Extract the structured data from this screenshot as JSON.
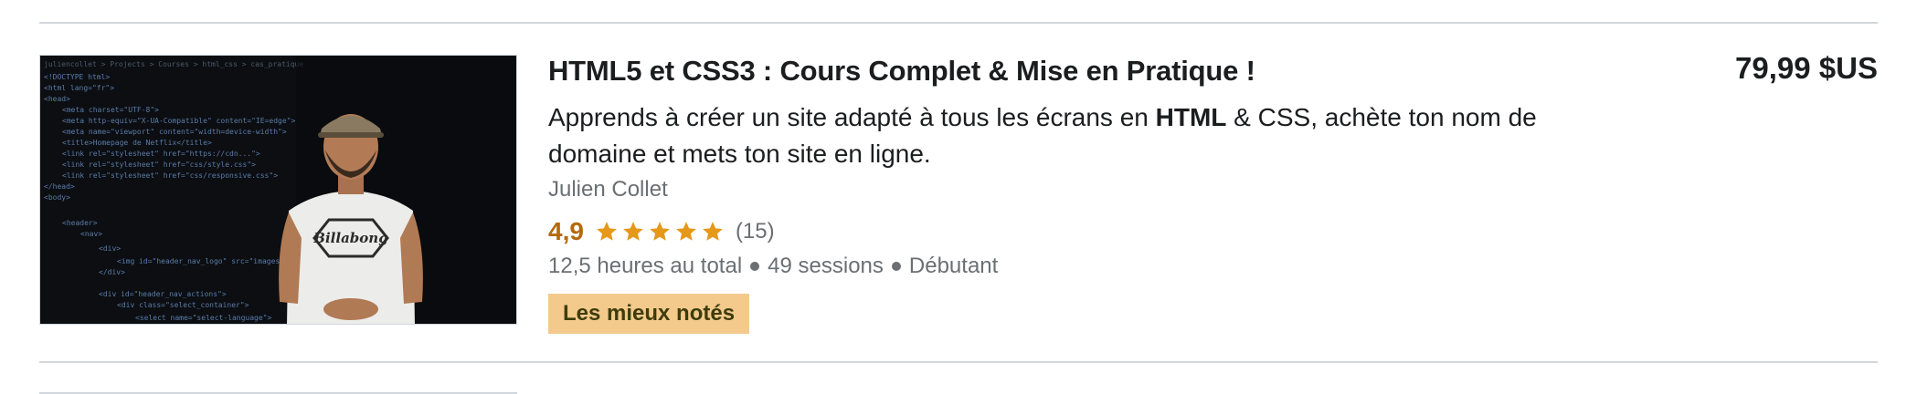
{
  "course": {
    "title": "HTML5 et CSS3 : Cours Complet & Mise en Pratique !",
    "description_pre": "Apprends à créer un site adapté à tous les écrans en ",
    "description_bold": "HTML",
    "description_post": " & CSS, achète ton nom de domaine et mets ton site en ligne.",
    "instructor": "Julien Collet",
    "rating": "4,9",
    "rating_stars": 4.9,
    "reviews": "(15)",
    "hours": "12,5 heures au total",
    "lectures": "49 sessions",
    "level": "Débutant",
    "badge": "Les mieux notés",
    "price": "79,99 $US",
    "thumbnail_alt": "Instructor standing in front of HTML code",
    "star_color": "#e59819",
    "badge_color": "#f3ca8c"
  }
}
